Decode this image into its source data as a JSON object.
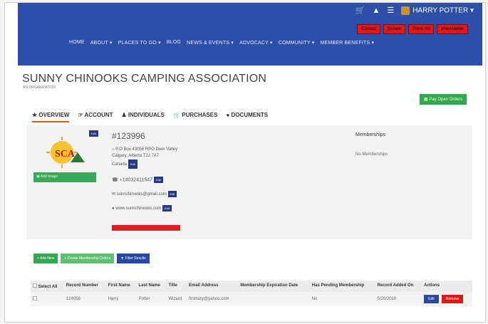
{
  "header": {
    "user_name": "HARRY POTTER",
    "user_chevron": "▾",
    "icons": [
      "cart-icon",
      "alert-icon",
      "menu-icon"
    ],
    "buttons": [
      "Contact",
      "Donate",
      "Press Kit",
      "eNewsletter"
    ],
    "nav": [
      "HOME",
      "ABOUT ▾",
      "PLACES TO GO ▾",
      "BLOG",
      "NEWS & EVENTS ▾",
      "ADVOCACY ▾",
      "COMMUNITY ▾",
      "MEMBER BENEFITS ▾"
    ]
  },
  "org": {
    "title": "SUNNY CHINOOKS CAMPING ASSOCIATION",
    "subtitle": "AN ORGANIZATION",
    "pay_button": "Pay Open Orders"
  },
  "tabs": [
    "OVERVIEW",
    "ACCOUNT",
    "INDIVIDUALS",
    "PURCHASES",
    "DOCUMENTS"
  ],
  "tab_icons": [
    "★",
    "☞",
    "♟",
    "🛒",
    "●"
  ],
  "record": {
    "number": "#123996",
    "address_line1": "P.O Box 43056 RPO Deer Valley",
    "address_line2": "Calgary, Alberta T2J 7A7",
    "address_line3": "Canada",
    "phone": "+14032411547",
    "email": "sunnchinooks@gmail.com",
    "website": "www.sunnchinooks.com",
    "edit_label": "Edit",
    "add_image": "Add Image",
    "logo_text": "SCA"
  },
  "memberships": {
    "heading": "Memberships",
    "empty_text": "No Memberships"
  },
  "actions": [
    "+ Add New",
    "+ Create Membership Orders",
    "Filter Results"
  ],
  "table": {
    "columns": [
      "Select All",
      "Record Number",
      "First Name",
      "Last Name",
      "Title",
      "Email Address",
      "Membership Expiration Date",
      "Has Pending Membership",
      "Record Added On",
      "Actions"
    ],
    "rows": [
      {
        "record_number": "124056",
        "first_name": "Harry",
        "last_name": "Potter",
        "title": "Wizard",
        "email": "firstrazy@yahoo.com",
        "expiration": "",
        "pending": "No",
        "added_on": "5/20/2019",
        "edit": "Edit",
        "remove": "Remove"
      }
    ]
  }
}
